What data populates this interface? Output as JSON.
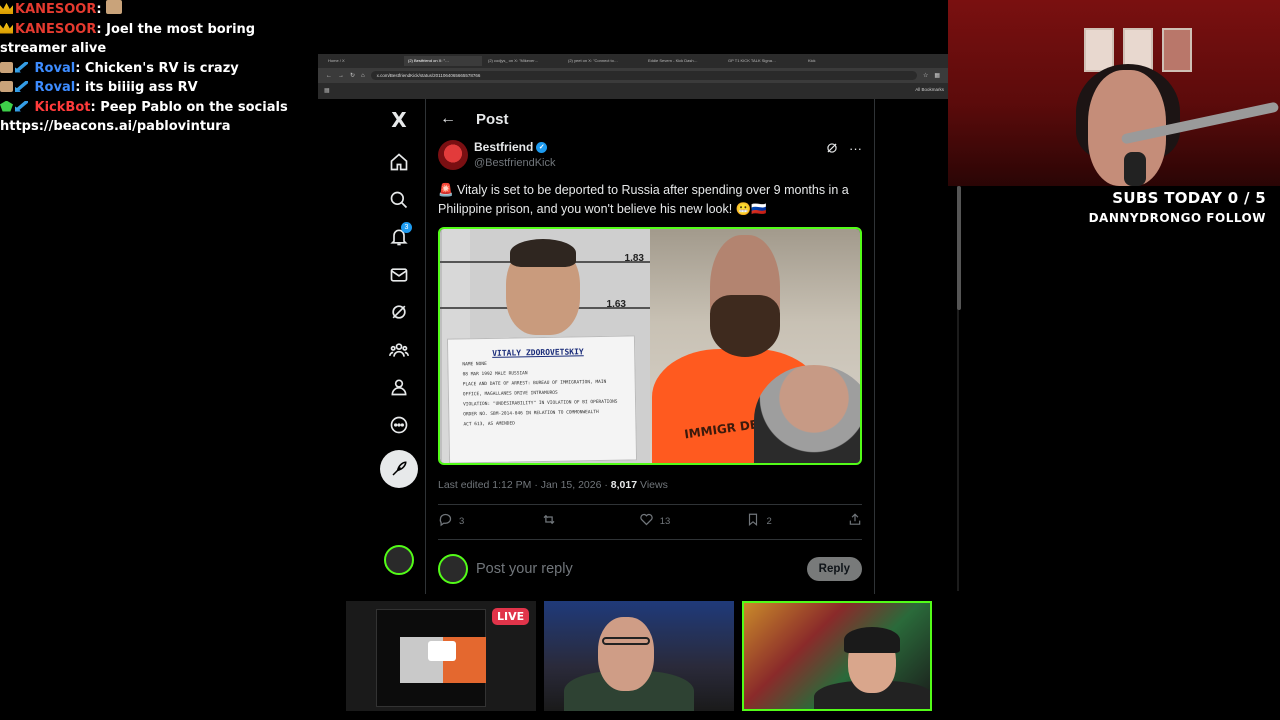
{
  "chat": {
    "messages": [
      {
        "user": "KANESOOR",
        "sep": ":",
        "text": ""
      },
      {
        "user": "KANESOOR",
        "sep": ":",
        "text": " Joel the most boring streamer alive"
      },
      {
        "user": "Roval",
        "sep": ":",
        "text": " Chicken's RV is crazy"
      },
      {
        "user": "Roval",
        "sep": ":",
        "text": " its biiiig ass RV"
      },
      {
        "user": "KickBot",
        "sep": ":",
        "text": " Peep Pablo on the socials https://beacons.ai/pablovintura"
      }
    ]
  },
  "browser": {
    "tabs": [
      "Home / X",
      "(2) Bestfriend on X: \"…",
      "(2) codjys_ on X: \"Mikexer…",
      "(2) yeet on X: \"Connect to…",
      "Eddie Severn - Kick Dash…",
      "GP T1 KICK TALK Signa…",
      "Kick"
    ],
    "url": "x.com/BestfriendKick/status/2011064065665578766",
    "bookmarks_label": "All Bookmarks"
  },
  "x_nav": {
    "logo": "X",
    "notification_count": "3",
    "icons": [
      "home-icon",
      "search-icon",
      "bell-icon",
      "mail-icon",
      "grok-icon",
      "communities-icon",
      "profile-icon",
      "more-icon",
      "compose-icon"
    ]
  },
  "post": {
    "header_title": "Post",
    "author_name": "Bestfriend",
    "author_handle": "@BestfriendKick",
    "text": "🚨 Vitaly is set to be deported to Russia after spending over 9 months in a Philippine prison, and you won't believe his new look! 😬🇷🇺",
    "media": {
      "ruler_top": "1.83",
      "ruler_mid": "1.63",
      "sign_name": "VITALY ZDOROVETSKIY",
      "sign_lines": [
        "NAME   NONE",
        "08 MAR 1992      MALE       RUSSIAN",
        "PLACE AND DATE OF ARREST:  BUREAU OF IMMIGRATION, MAIN",
        "OFFICE, MAGALLANES DRIVE INTRAMUROS",
        "VIOLATION: \"UNDESIRABILITY\" IN VIOLATION OF BI OPERATIONS",
        "ORDER NO. SBM-2014-046 IN RELATION TO COMMONWEALTH",
        "ACT 613, AS AMENDED"
      ],
      "shirt_text": "IMMIGR  DEPO"
    },
    "edited_prefix": "Last edited",
    "edited_time": "1:12 PM · Jan 15, 2026 ·",
    "views_count": "8,017",
    "views_label": "Views",
    "stats": {
      "replies": "3",
      "reposts": "",
      "likes": "13",
      "bookmarks": "2"
    },
    "reply_placeholder": "Post your reply",
    "reply_button": "Reply"
  },
  "overlay": {
    "subs_label": "SUBS TODAY 0 / 5",
    "follow_label": "DANNYDRONGO FOLLOW"
  },
  "cams": {
    "live_badge": "LIVE"
  },
  "colors": {
    "kick_green": "#53fc18",
    "x_blue": "#1d9bf0",
    "live_red": "#e1344a"
  }
}
